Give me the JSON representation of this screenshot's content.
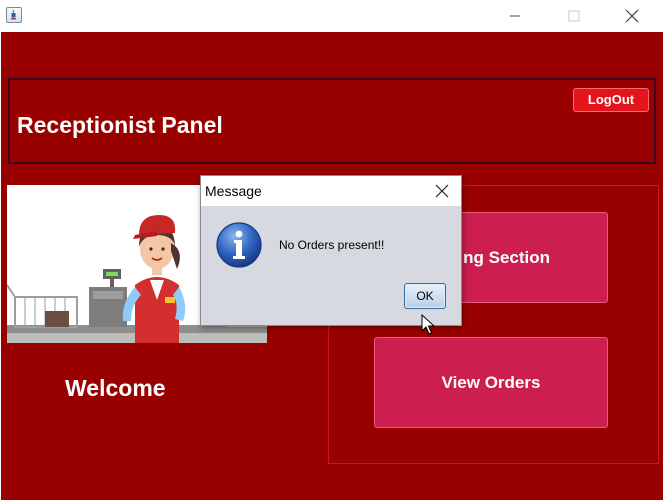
{
  "window": {
    "icon": "java-coffee-cup-icon",
    "controls": [
      "minimize-icon",
      "maximize-icon",
      "close-icon"
    ]
  },
  "header": {
    "title": "Receptionist Panel",
    "logout_label": "LogOut"
  },
  "main": {
    "illustration": "cashier-illustration",
    "welcome_text": "Welcome",
    "billing_button_label": "Billing Section",
    "view_orders_label": "View Orders"
  },
  "dialog": {
    "title": "Message",
    "message": "No Orders present!!",
    "ok_label": "OK",
    "icon": "info-icon"
  },
  "colors": {
    "background": "#990000",
    "button_accent": "#cc1e4f",
    "logout": "#e3141c"
  }
}
